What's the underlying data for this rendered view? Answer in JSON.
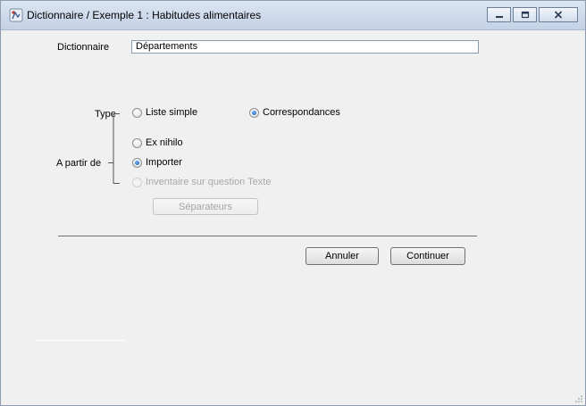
{
  "window": {
    "title": "Dictionnaire / Exemple 1 : Habitudes alimentaires",
    "icons": [
      "app-icon",
      "minimize-icon",
      "maximize-icon",
      "close-icon"
    ]
  },
  "form": {
    "dictionary_label": "Dictionnaire",
    "dictionary_value": "Départements",
    "type_label": "Type",
    "type_options": [
      {
        "label": "Liste simple",
        "checked": false
      },
      {
        "label": "Correspondances",
        "checked": true
      }
    ],
    "from_label": "A partir de",
    "from_options": [
      {
        "label": "Ex nihilo",
        "checked": false,
        "enabled": true
      },
      {
        "label": "Importer",
        "checked": true,
        "enabled": true
      },
      {
        "label": "Inventaire sur question Texte",
        "checked": false,
        "enabled": false
      }
    ],
    "separators_button": "Séparateurs"
  },
  "footer": {
    "cancel_label": "Annuler",
    "continue_label": "Continuer"
  },
  "colors": {
    "titlebar": "#cdd9ea",
    "background": "#f0f0f0",
    "radio_selected": "#1a55a8"
  }
}
